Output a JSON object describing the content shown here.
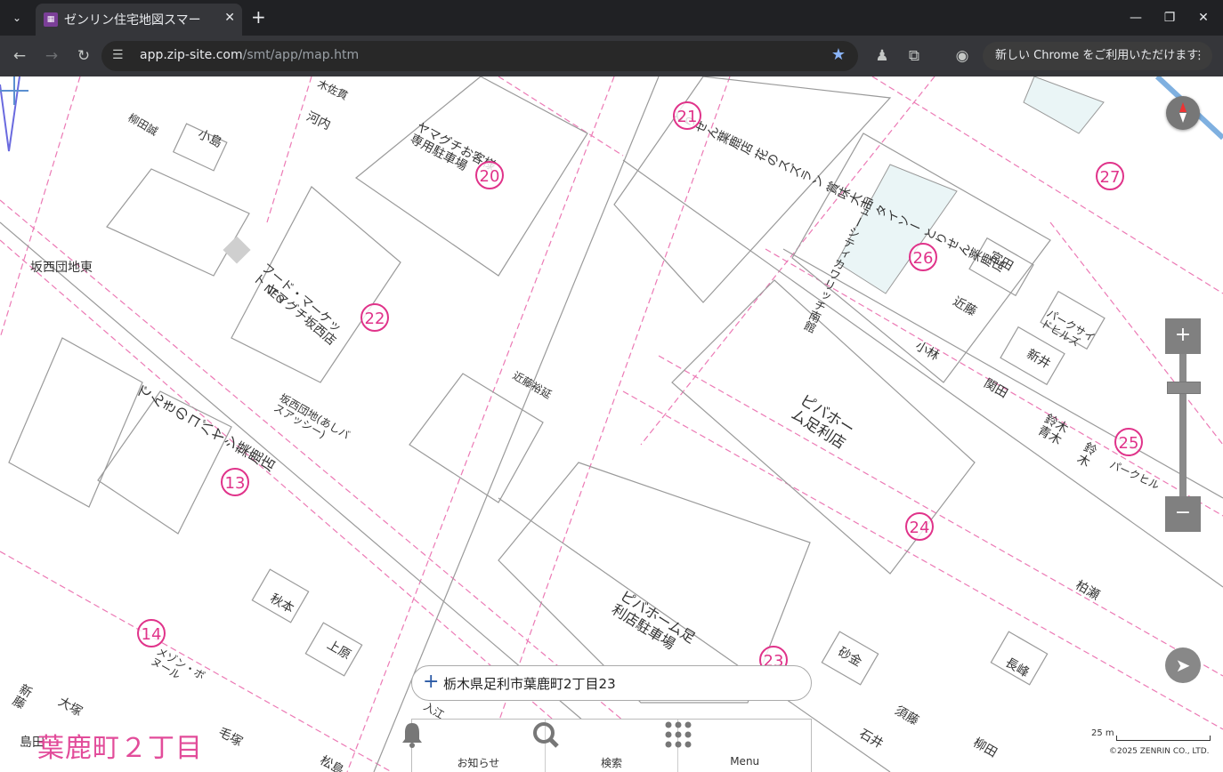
{
  "browser": {
    "tab_title": "ゼンリン住宅地図スマー",
    "url_host": "app.zip-site.com",
    "url_path": "/smt/app/map.htm",
    "update_button": "新しい Chrome をご利用いただけます",
    "icons": {
      "tab_menu": "chevron-down-icon",
      "close": "close-icon",
      "new_tab": "plus-icon",
      "back": "arrow-left-icon",
      "forward": "arrow-right-icon",
      "reload": "reload-icon",
      "bookmark": "star-icon",
      "extensions": "puzzle-icon",
      "profile": "profile-icon"
    }
  },
  "map": {
    "town_label": "葉鹿町２丁目",
    "place_labels": [
      {
        "text": "柳田誠"
      },
      {
        "text": "小島"
      },
      {
        "text": "河内"
      },
      {
        "text": "木佐貫"
      },
      {
        "text": "ヤマグチお客様専用駐車場"
      },
      {
        "text": "とりせん葉鹿店 花のスズラン 賞味大吉 タイソー とりせん薬鹿店"
      },
      {
        "text": "坂西団地東"
      },
      {
        "text": "フード・マーケット ヤマグチ坂西店"
      },
      {
        "text": "NEO"
      },
      {
        "text": "ニューシティカワリッチ南館"
      },
      {
        "text": "宮田"
      },
      {
        "text": "近藤"
      },
      {
        "text": "小林"
      },
      {
        "text": "パークサイドヒルズ"
      },
      {
        "text": "新井"
      },
      {
        "text": "関田"
      },
      {
        "text": "鈴木青木"
      },
      {
        "text": "鈴木"
      },
      {
        "text": "パークヒル"
      },
      {
        "text": "ピバホーム足利店"
      },
      {
        "text": "近藤裕延"
      },
      {
        "text": "でんきのコバヤシ葉鹿店"
      },
      {
        "text": "坂西団地(あしバスアッシー)"
      },
      {
        "text": "ピバホーム足利店駐車場"
      },
      {
        "text": "秋本"
      },
      {
        "text": "上原"
      },
      {
        "text": "砂金"
      },
      {
        "text": "長峰"
      },
      {
        "text": "柏瀬"
      },
      {
        "text": "石井"
      },
      {
        "text": "柳田"
      },
      {
        "text": "新藤"
      },
      {
        "text": "大塚"
      },
      {
        "text": "島田"
      },
      {
        "text": "毛塚"
      },
      {
        "text": "メゾン・ボヌール"
      },
      {
        "text": "須藤"
      },
      {
        "text": "入江"
      },
      {
        "text": "松島"
      }
    ],
    "block_numbers": [
      "21",
      "20",
      "22",
      "26",
      "27",
      "13",
      "14",
      "24",
      "25",
      "23"
    ],
    "address": "栃木県足利市葉鹿町2丁目23",
    "scale": "25 m",
    "copyright": "©2025 ZENRIN CO., LTD.",
    "controls": {
      "zoom_in": "+",
      "zoom_out": "−",
      "compass_icon": "compass-icon",
      "locate_icon": "navigation-arrow-icon"
    }
  },
  "bottom_nav": [
    {
      "label": "お知らせ",
      "icon": "bell-icon"
    },
    {
      "label": "検索",
      "icon": "search-icon"
    },
    {
      "label": "Menu",
      "icon": "grid-menu-icon"
    }
  ]
}
